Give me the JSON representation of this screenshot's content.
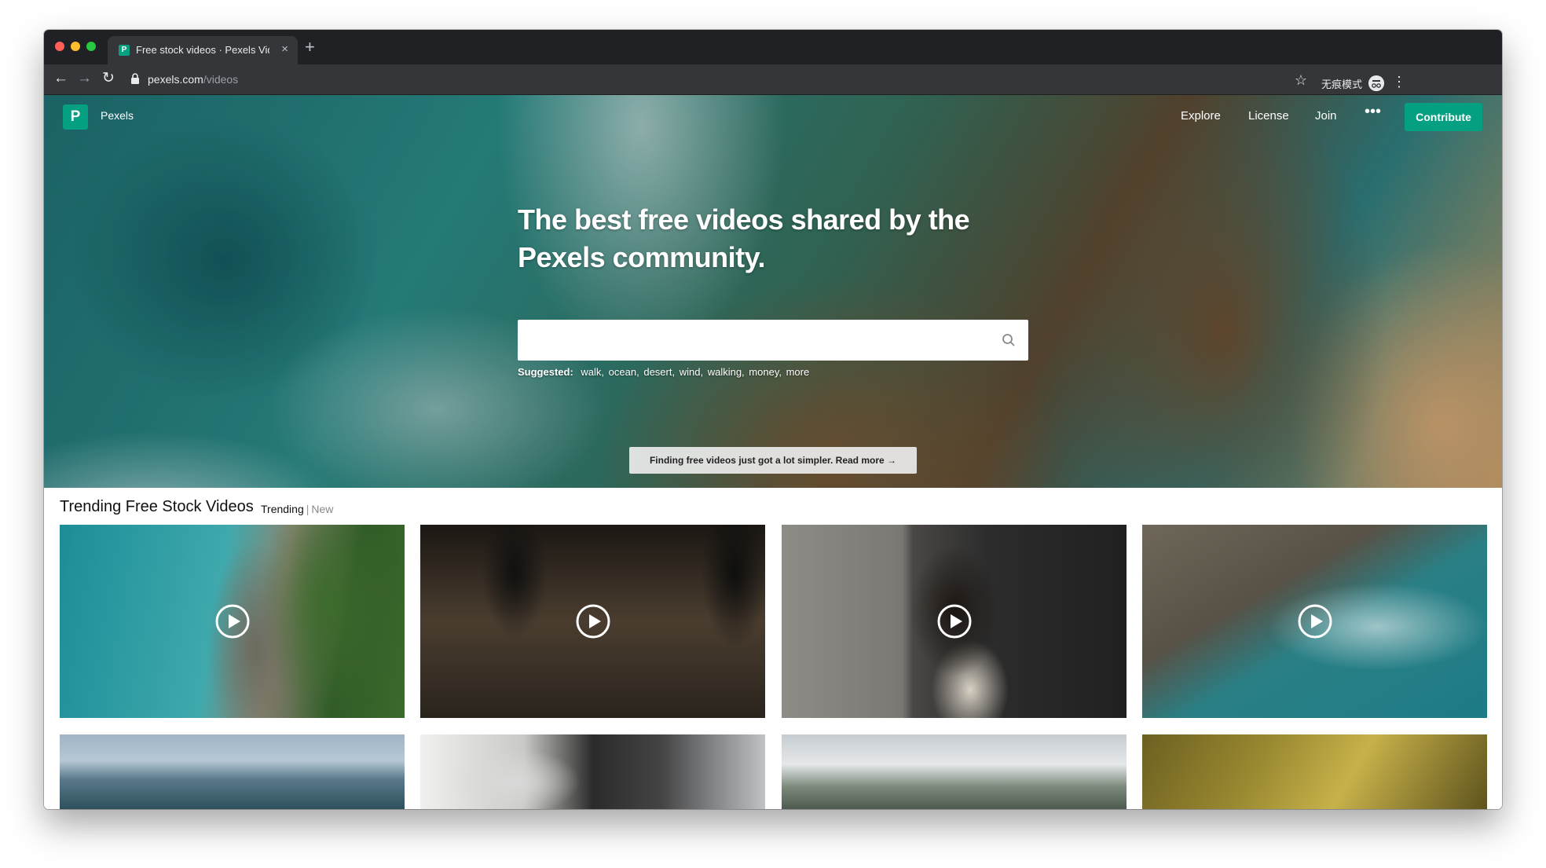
{
  "browser": {
    "tab_title": "Free stock videos · Pexels Videos",
    "new_tab_symbol": "+",
    "close_symbol": "×",
    "url_host": "pexels.com",
    "url_path": "/videos",
    "profile_label": "无痕模式"
  },
  "site": {
    "brand": "Pexels",
    "logo_letter": "P",
    "nav": {
      "explore": "Explore",
      "license": "License",
      "join": "Join",
      "more": "•••",
      "contribute": "Contribute"
    },
    "hero": {
      "headline": "The best free videos shared by the Pexels community.",
      "search_value": "",
      "suggested_label": "Suggested:",
      "suggestions": [
        "walk,",
        "ocean,",
        "desert,",
        "wind,",
        "walking,",
        "money,",
        "more"
      ],
      "notice": "Finding free videos just got a lot simpler. Read more →"
    },
    "trending": {
      "title": "Trending Free Stock Videos",
      "tab_trending": "Trending",
      "separator": "|",
      "tab_new": "New"
    }
  },
  "colors": {
    "brand_green": "#05a081",
    "chrome_dark": "#202124",
    "chrome_toolbar": "#35363a"
  },
  "icons": [
    "back-arrow-icon",
    "forward-arrow-icon",
    "reload-icon",
    "lock-icon",
    "star-icon",
    "incognito-icon",
    "menu-dots-icon",
    "search-icon",
    "play-icon"
  ]
}
